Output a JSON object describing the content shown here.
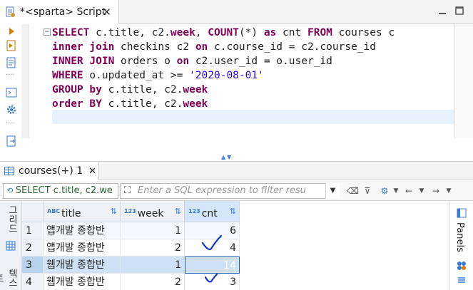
{
  "editor_tab": {
    "title": "*<sparta> Script",
    "close": "✕"
  },
  "sql_lines": [
    [
      {
        "t": "SELECT",
        "k": true
      },
      {
        "t": " c.title, c2."
      },
      {
        "t": "week",
        "k": true
      },
      {
        "t": ", "
      },
      {
        "t": "COUNT",
        "k": true
      },
      {
        "t": "(*) "
      },
      {
        "t": "as",
        "k": true
      },
      {
        "t": " cnt "
      },
      {
        "t": "FROM",
        "k": true
      },
      {
        "t": " courses c"
      }
    ],
    [
      {
        "t": "inner join",
        "k": true
      },
      {
        "t": " checkins c2 "
      },
      {
        "t": "on",
        "k": true
      },
      {
        "t": " c.course_id = c2.course_id"
      }
    ],
    [
      {
        "t": "INNER JOIN",
        "k": true
      },
      {
        "t": " orders o "
      },
      {
        "t": "on",
        "k": true
      },
      {
        "t": " c2.user_id = o.user_id"
      }
    ],
    [
      {
        "t": "WHERE",
        "k": true
      },
      {
        "t": " o.updated_at >= "
      },
      {
        "t": "'2020-08-01'",
        "s": true
      }
    ],
    [
      {
        "t": "GROUP",
        "k": true
      },
      {
        "t": " "
      },
      {
        "t": "by",
        "k": true
      },
      {
        "t": " c.title, c2."
      },
      {
        "t": "week",
        "k": true
      }
    ],
    [
      {
        "t": "order",
        "k": true
      },
      {
        "t": " "
      },
      {
        "t": "BY",
        "k": true
      },
      {
        "t": " c.title, c2."
      },
      {
        "t": "week",
        "k": true
      }
    ]
  ],
  "results_tab": {
    "label": "courses(+) 1",
    "close": "✕"
  },
  "filterbar": {
    "query_text": "SELECT c.title, c2.we",
    "filter_placeholder": "Enter a SQL expression to filter resu"
  },
  "side_tools": {
    "grid_label": "그리드",
    "text_label": "텍스트"
  },
  "columns": [
    {
      "type": "ABC",
      "name": "title"
    },
    {
      "type": "123",
      "name": "week"
    },
    {
      "type": "123",
      "name": "cnt"
    }
  ],
  "rows": [
    {
      "n": "1",
      "title": "앱개발 종합반",
      "week": "1",
      "cnt": "6"
    },
    {
      "n": "2",
      "title": "앱개발 종합반",
      "week": "2",
      "cnt": "4"
    },
    {
      "n": "3",
      "title": "웹개발 종합반",
      "week": "1",
      "cnt": "14"
    },
    {
      "n": "4",
      "title": "웹개발 종합반",
      "week": "2",
      "cnt": "3"
    }
  ],
  "right_panel": {
    "label": "Panels"
  },
  "colors": {
    "keyword": "#7f0055",
    "string": "#2a00ff",
    "accent": "#2f7ad6",
    "annotation": "#1533c9"
  }
}
